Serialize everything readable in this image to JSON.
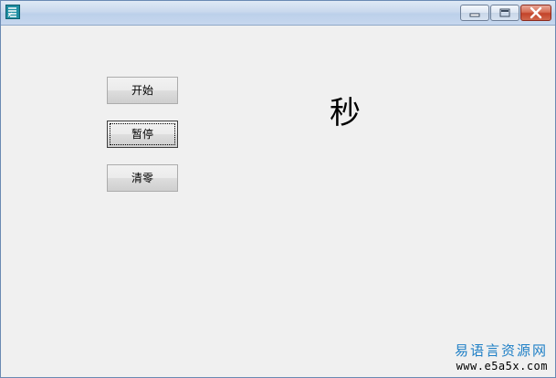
{
  "window": {
    "title": "",
    "icon": "app-icon"
  },
  "controls": {
    "minimize_icon": "minimize-icon",
    "maximize_icon": "maximize-icon",
    "close_icon": "close-icon"
  },
  "buttons": {
    "start_label": "开始",
    "pause_label": "暂停",
    "clear_label": "清零"
  },
  "display": {
    "seconds_text": "秒"
  },
  "watermark": {
    "title": "易语言资源网",
    "url": "www.e5a5x.com"
  },
  "colors": {
    "accent": "#1e7fc6",
    "close_button": "#c3432a",
    "window_bg": "#f0f0f0"
  }
}
